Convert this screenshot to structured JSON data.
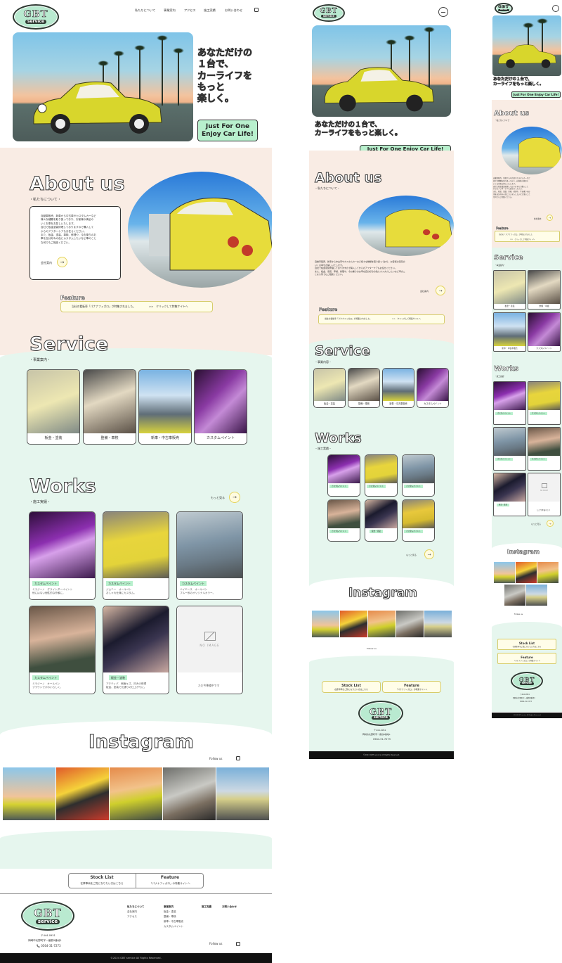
{
  "brand": {
    "name": "GBT",
    "sub": "service",
    "ring_text": "Car Maintenance Customize Shop"
  },
  "colors": {
    "mint": "#b8f0cd",
    "peach": "#f9ece4",
    "mint_bg": "#e6f6ee",
    "dark": "#2f3a33",
    "yellow": "#e7dc3b"
  },
  "nav": [
    "私たちについて",
    "事業案内",
    "アクセス",
    "施工実績",
    "お問い合わせ"
  ],
  "hero": {
    "copy_lines": [
      "あなただけの",
      "１台で、",
      "カーライフを",
      "もっと",
      "楽しく。"
    ],
    "copy_mobile_lines": [
      "あなただけの１台で、",
      "カーライフをもっと楽しく。"
    ],
    "tagline_lines": [
      "Just For One",
      "Enjoy Car Life!"
    ],
    "tagline_one": "Just For One Enjoy Car Life!"
  },
  "about": {
    "title": "About us",
    "subtitle": "・私たちについて・",
    "subtitle_mobile": "・私たちについて・",
    "body_lines": [
      "自動車販売、新車から中古車やカスタムカーなど",
      "様々な種類を取り扱っており、お客様の満足の",
      "いくお車をお探しいたします。",
      "自社で板金塗装修理しておりますので購入して",
      "からのアフターケアもお任せください。",
      "また、板金、塗装、車検、修理や、今お乗りのお",
      "車を自分好みの色にカスタムしたいなど車のこと",
      "な何でもご相談ください。"
    ],
    "body_mid_lines": [
      "自動車販売、新車から中古車やカスタムカーなど様々な種類を取り扱っており、お客様の満足の",
      "いくお車をお探しいたします。",
      "自社で板金塗装修理しておりますので購入してからのアフターケアもお任せください。",
      "また、板金、塗装、車検、修理や、今お乗りのお車を自分好みの色にカスタムしたいなど車のこ",
      "となら何でもご相談ください。"
    ],
    "link": "会社案内"
  },
  "feature": {
    "label": "Feature",
    "text": "当社の看板車「パナナフィガロ」が特集されました。",
    "link": ">>　クリックして特集サイトへ",
    "text_mid": "当社の看板車「パナナフィガロ」が特集されました。",
    "link_mid": ">>　クリックして特集サイトへ",
    "text_sm": "当社の「パナナフィガロ」が特集されました",
    "link_sm": ">>　クリックして特集サイトへ"
  },
  "service": {
    "title": "Service",
    "subtitle": "・事業案内・",
    "subtitle_mid": "・事業内容・",
    "subtitle_sm": "・事業案内・",
    "items": [
      "板金・塗装",
      "整備・車検",
      "新車・中古車販売",
      "カスタムペイント"
    ]
  },
  "works": {
    "title": "Works",
    "subtitle": "・施工実績・",
    "more": "もっと見る",
    "items": [
      {
        "tag": "カスタムペイント",
        "lines": [
          "ミラジーノ　グラインダーペイント",
          "他にはない個性的な外観に。"
        ]
      },
      {
        "tag": "カスタムペイント",
        "lines": [
          "ジムニー　オールペン",
          "おしゃれ仕様にカスタム。"
        ]
      },
      {
        "tag": "カスタムペイント",
        "lines": [
          "ハイエース　オールペン",
          "ブルー系のオリジナルカラー。"
        ]
      },
      {
        "tag": "カスタムペイント",
        "lines": [
          "ミラジーノ　オールペン",
          "ブラウンでかわいらしく。"
        ]
      },
      {
        "tag": "板金・塗装",
        "lines": [
          "アクティバ　側面キズ、凹みの修理",
          "板金、塗装で元通りの仕上がりに。"
        ]
      },
      {
        "tag": "",
        "lines": [
          "ただ今準備中です"
        ]
      }
    ],
    "no_image": "NO IMAGE"
  },
  "instagram": {
    "title": "Instagram",
    "follow": "Follow us"
  },
  "bottom_links": [
    {
      "title": "Stock List",
      "text": "在庫車両をご覧になりたい方はこちら"
    },
    {
      "title": "Feature",
      "text": "「パナナフィガロ」の特集サイトへ"
    }
  ],
  "footer": {
    "postal": "〒444-0951",
    "address": "岡崎市北野町字一番割9番地1",
    "phone": "0564-31-7273",
    "cols": [
      {
        "head": "私たちについて",
        "items": [
          "会社案内",
          "アクセス"
        ]
      },
      {
        "head": "事業案内",
        "items": [
          "板金・塗装",
          "整備・車検",
          "新車・中古車販売",
          "カスタムペイント"
        ]
      },
      {
        "head": "施工実績",
        "items": []
      },
      {
        "head": "お問い合わせ",
        "items": []
      }
    ],
    "copyright": "©2024 GBT service All Rights Reserved."
  }
}
